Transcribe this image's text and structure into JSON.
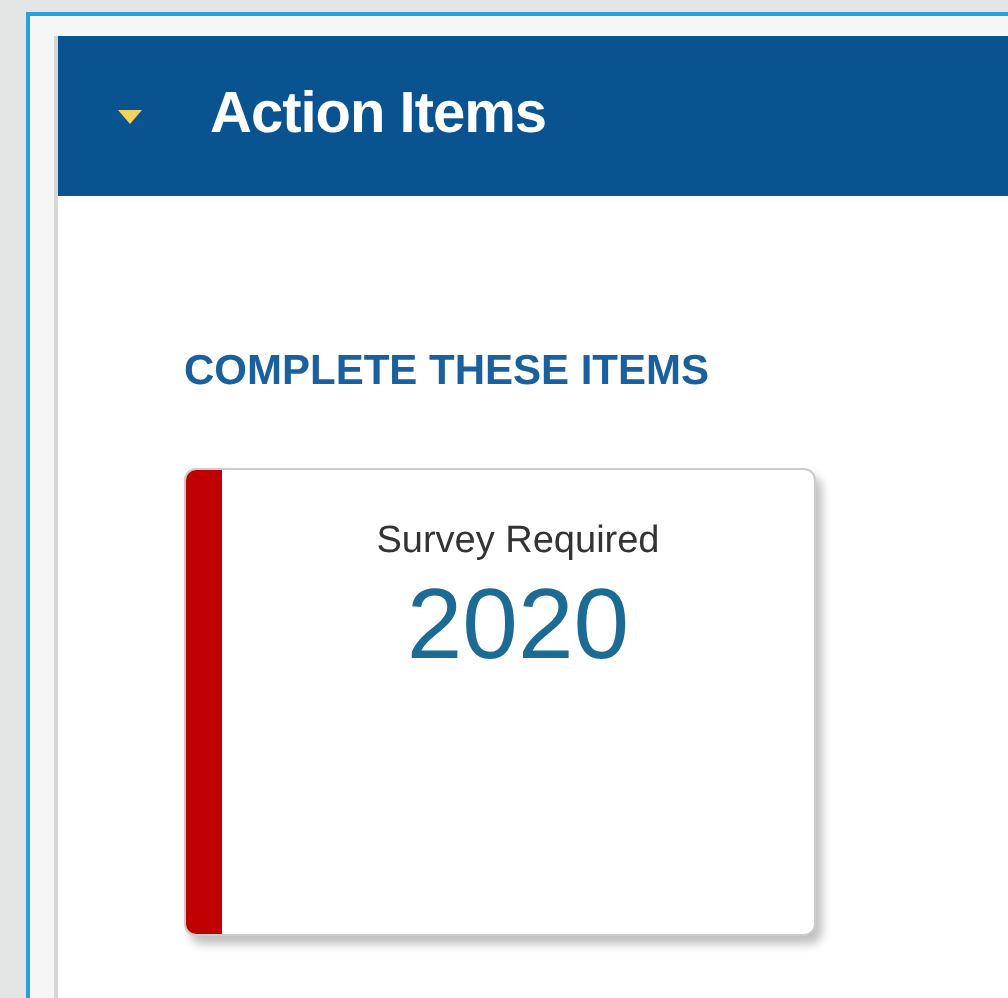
{
  "panel": {
    "title": "Action Items",
    "expanded": true
  },
  "section": {
    "heading": "COMPLETE THESE ITEMS"
  },
  "items": [
    {
      "label": "Survey Required",
      "value": "2020",
      "color": "#c00000"
    }
  ]
}
